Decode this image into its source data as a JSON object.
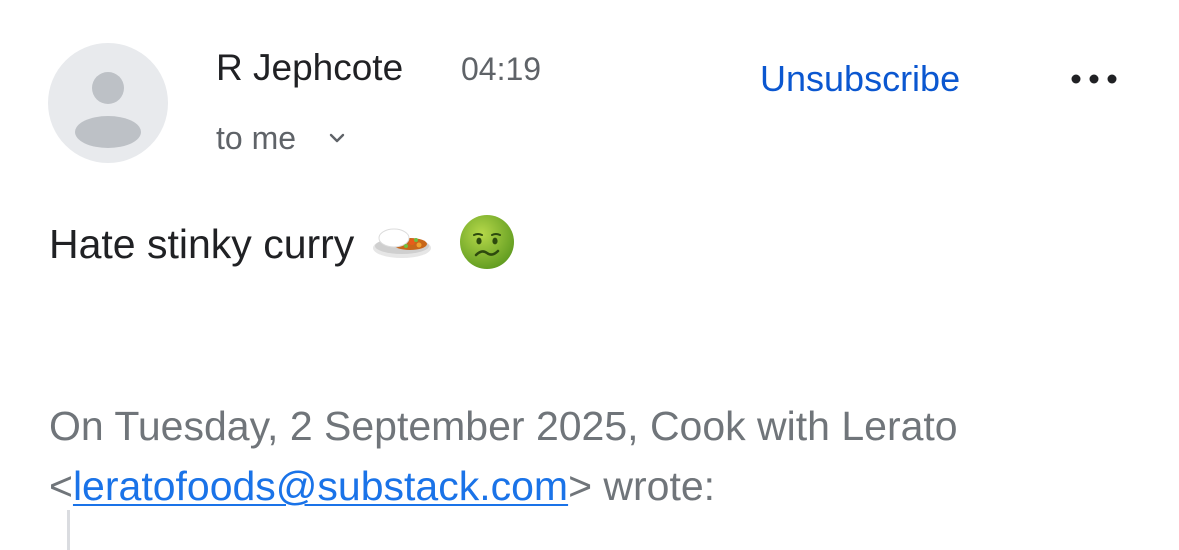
{
  "header": {
    "sender_name": "R Jephcote",
    "time": "04:19",
    "recipients_label": "to me",
    "unsubscribe_label": "Unsubscribe",
    "more_icon": "more-horizontal-icon",
    "expand_icon": "chevron-down-icon"
  },
  "message": {
    "body_text": "Hate stinky curry",
    "emojis": [
      "curry-rice-emoji",
      "nauseated-face-emoji"
    ]
  },
  "quote": {
    "intro": "On Tuesday, 2 September 2025, Cook with Lerato <",
    "email": "leratofoods@substack.com",
    "outro": "> wrote:"
  },
  "colors": {
    "link_blue": "#0b57d0",
    "email_link": "#1a73e8",
    "text_primary": "#202124",
    "text_secondary": "#5f6368",
    "quote_text": "#70757a",
    "avatar_bg": "#e8eaed"
  }
}
